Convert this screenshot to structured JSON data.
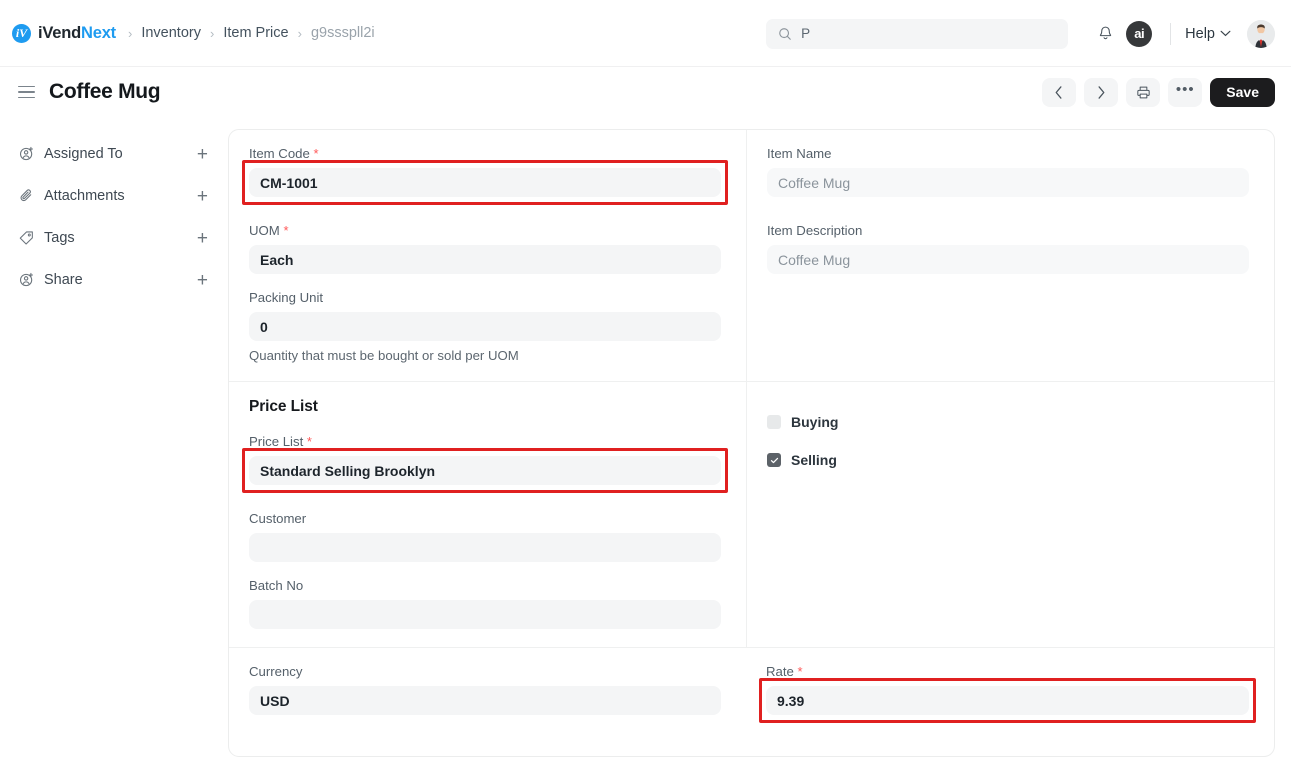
{
  "brand": {
    "name_dark": "iVend",
    "name_blue": "Next",
    "mark": "brand-logo-icon"
  },
  "breadcrumb": {
    "items": [
      {
        "label": "Inventory"
      },
      {
        "label": "Item Price"
      },
      {
        "label": "g9ssspll2i"
      }
    ],
    "separator": "›"
  },
  "topnav": {
    "search_value": "P",
    "search_placeholder": "Search",
    "ai_badge": "ai",
    "help_label": "Help",
    "chevron": "⌄"
  },
  "page": {
    "title": "Coffee Mug",
    "actions": {
      "prev": "‹",
      "next": "›",
      "print": "print-icon",
      "more": "•••",
      "save_label": "Save"
    }
  },
  "sidebar": {
    "items": [
      {
        "label": "Assigned To",
        "icon": "user-add-icon",
        "add": "+"
      },
      {
        "label": "Attachments",
        "icon": "paperclip-icon",
        "add": "+"
      },
      {
        "label": "Tags",
        "icon": "tag-icon",
        "add": "+"
      },
      {
        "label": "Share",
        "icon": "share-user-icon",
        "add": "+"
      }
    ]
  },
  "form": {
    "section_item": {
      "item_code": {
        "label": "Item Code",
        "required": "*",
        "value": "CM-1001"
      },
      "uom": {
        "label": "UOM",
        "required": "*",
        "value": "Each"
      },
      "packing_unit": {
        "label": "Packing Unit",
        "value": "0",
        "hint": "Quantity that must be bought or sold per UOM"
      },
      "item_name": {
        "label": "Item Name",
        "value": "Coffee Mug"
      },
      "item_description": {
        "label": "Item Description",
        "value": "Coffee Mug"
      }
    },
    "section_price_list": {
      "title": "Price List",
      "price_list": {
        "label": "Price List",
        "required": "*",
        "value": "Standard Selling Brooklyn"
      },
      "customer": {
        "label": "Customer",
        "value": ""
      },
      "batch_no": {
        "label": "Batch No",
        "value": ""
      },
      "buying": {
        "label": "Buying",
        "checked": false
      },
      "selling": {
        "label": "Selling",
        "checked": true
      }
    },
    "section_rate": {
      "currency": {
        "label": "Currency",
        "value": "USD"
      },
      "rate": {
        "label": "Rate",
        "required": "*",
        "value": "9.39"
      }
    }
  },
  "colors": {
    "brand_blue": "#1e9bf0",
    "highlight_red": "#e02020",
    "required_red": "#ff5858",
    "save_black": "#1c1c1e",
    "field_bg": "#f4f5f6"
  }
}
